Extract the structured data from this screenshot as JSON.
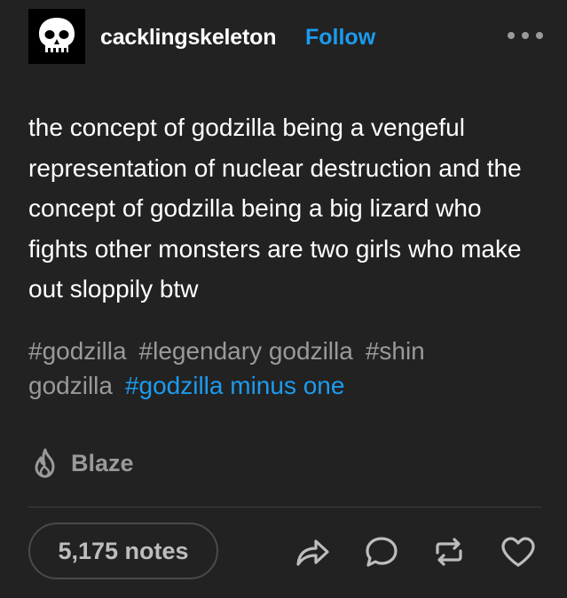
{
  "post": {
    "username": "cacklingskeleton",
    "follow_label": "Follow",
    "avatar_icon": "skull-icon",
    "body": "the concept of godzilla being a vengeful representation of nuclear destruction and the concept of godzilla being a big lizard who fights other monsters are two girls who make out sloppily btw",
    "tags": [
      {
        "label": "#godzilla",
        "active": false
      },
      {
        "label": "#legendary godzilla",
        "active": false
      },
      {
        "label": "#shin godzilla",
        "active": false
      },
      {
        "label": "#godzilla minus one",
        "active": true
      }
    ],
    "blaze_label": "Blaze",
    "notes_label": "5,175 notes"
  },
  "actions": [
    "share-icon",
    "reply-icon",
    "reblog-icon",
    "like-icon"
  ],
  "colors": {
    "background": "#222222",
    "accent": "#1c9bef",
    "muted": "#9a9a9a",
    "text": "#ffffff"
  }
}
